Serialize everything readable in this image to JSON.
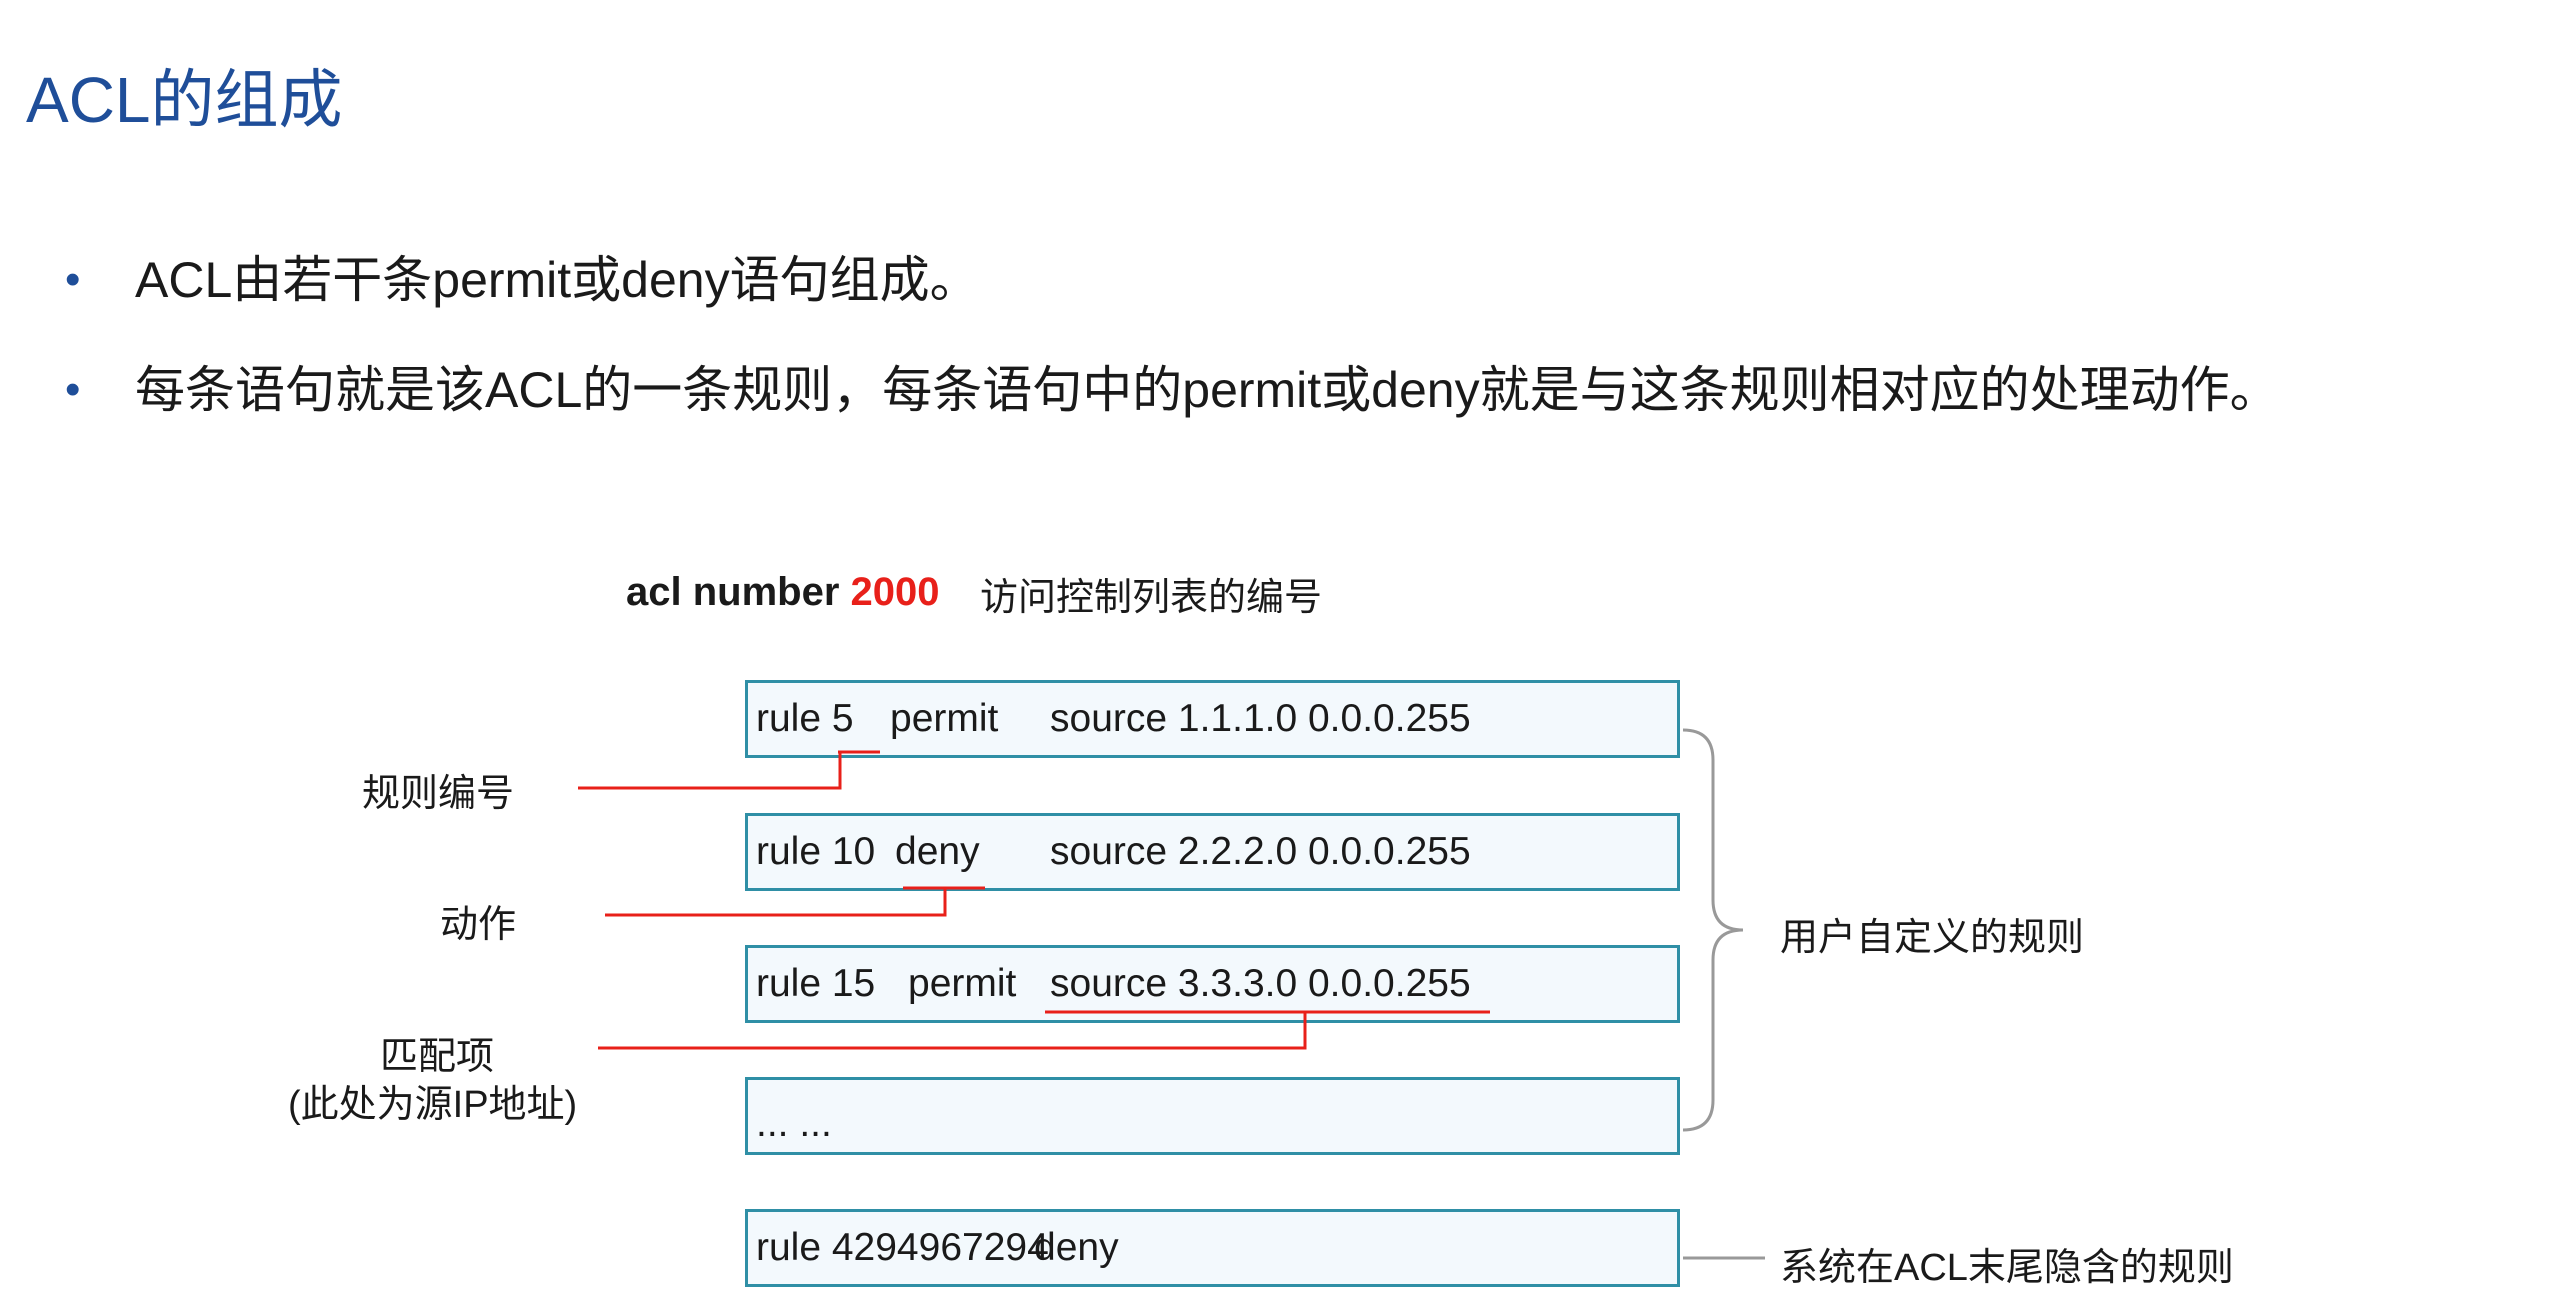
{
  "title": "ACL的组成",
  "bullets": [
    "ACL由若干条permit或deny语句组成。",
    "每条语句就是该ACL的一条规则，每条语句中的permit或deny就是与这条规则相对应的处理动作。"
  ],
  "bullet_marker": "•",
  "diagram": {
    "header_prefix": "acl number",
    "header_number": "2000",
    "header_desc": "访问控制列表的编号",
    "rules": [
      {
        "rule": "rule 5",
        "action": "permit",
        "match": "source 1.1.1.0 0.0.0.255"
      },
      {
        "rule": "rule 10",
        "action": "deny",
        "match": "source 2.2.2.0 0.0.0.255"
      },
      {
        "rule": "rule 15",
        "action": "permit",
        "match": "source 3.3.3.0 0.0.0.255"
      },
      {
        "rule": "... ...",
        "action": "",
        "match": ""
      },
      {
        "rule": "rule 4294967294",
        "action": "deny",
        "match": ""
      }
    ],
    "labels": {
      "rule_number": "规则编号",
      "action": "动作",
      "match_line1": "匹配项",
      "match_line2": "(此处为源IP地址)",
      "user_defined": "用户自定义的规则",
      "implicit": "系统在ACL末尾隐含的规则"
    },
    "colors": {
      "box_border": "#2f8fa6",
      "box_fill": "#f3f9fd",
      "annotation_line": "#e8201a",
      "brace": "#999999",
      "title": "#1f4e99"
    }
  }
}
